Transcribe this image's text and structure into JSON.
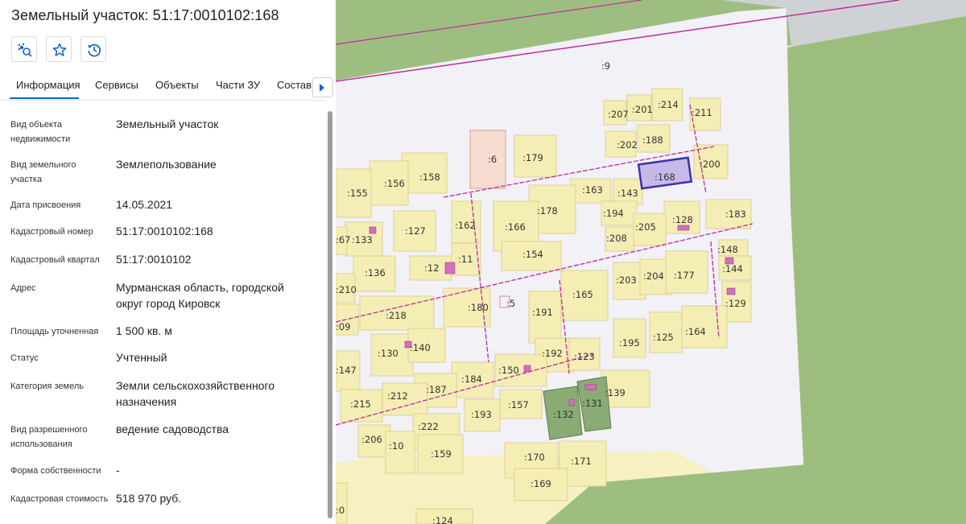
{
  "header": {
    "title": "Земельный участок: 51:17:0010102:168"
  },
  "toolbar": {
    "buttons": [
      "area-search-icon",
      "star-icon",
      "history-icon"
    ]
  },
  "tabs": [
    "Информация",
    "Сервисы",
    "Объекты",
    "Части ЗУ",
    "Состав"
  ],
  "active_tab": "Информация",
  "info": [
    {
      "label": "Вид объекта недвижимости",
      "value": "Земельный участок"
    },
    {
      "label": "Вид земельного участка",
      "value": "Землепользование"
    },
    {
      "label": "Дата присвоения",
      "value": "14.05.2021"
    },
    {
      "label": "Кадастровый номер",
      "value": "51:17:0010102:168"
    },
    {
      "label": "Кадастровый квартал",
      "value": "51:17:0010102"
    },
    {
      "label": "Адрес",
      "value": "Мурманская область, городской округ город Кировск"
    },
    {
      "label": "Площадь уточненная",
      "value": "1 500 кв. м"
    },
    {
      "label": "Статус",
      "value": "Учтенный"
    },
    {
      "label": "Категория земель",
      "value": "Земли сельскохозяйственного назначения"
    },
    {
      "label": "Вид разрешенного использования",
      "value": "ведение садоводства"
    },
    {
      "label": "Форма собственности",
      "value": "-"
    },
    {
      "label": "Кадастровая стоимость",
      "value": "518 970 руб."
    }
  ],
  "map": {
    "selected_parcel": ":168",
    "colors": {
      "parcel": "#f5eeb4",
      "selected": "#3f2fb0",
      "boundary": "#c02a9f",
      "green": "#9dbd7e",
      "water_bg": "#f1f1f6"
    },
    "labels": [
      ":9",
      ":207",
      ":201",
      ":214",
      ":211",
      ":202",
      ":188",
      ":6",
      ":179",
      ":168",
      ":200",
      ":158",
      ":156",
      ":155",
      ":163",
      ":143",
      ":178",
      ":194",
      ":128",
      ":183",
      ":166",
      ":208",
      ":205",
      ":127",
      ":162",
      ":133",
      ":67",
      ":154",
      ":148",
      ":144",
      ":136",
      ":12",
      ":11",
      ":203",
      ":204",
      ":177",
      ":210",
      ":165",
      ":129",
      ":218",
      ":180",
      ":5",
      ":191",
      ":09",
      ":195",
      ":125",
      ":164",
      ":130",
      ":140",
      ":192",
      ":123",
      ":147",
      ":150",
      ":184",
      ":139",
      ":187",
      ":131",
      ":215",
      ":212",
      ":157",
      ":193",
      ":132",
      ":222",
      ":206",
      ":10",
      ":159",
      ":170",
      ":171",
      ":169",
      ":0",
      ":124"
    ]
  }
}
